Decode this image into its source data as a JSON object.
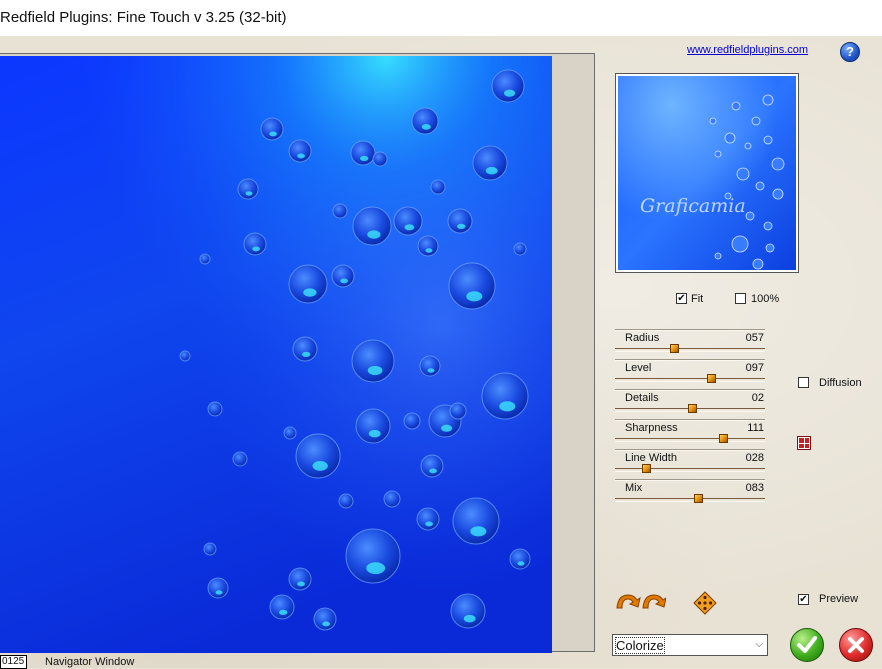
{
  "window": {
    "title": "Redfield Plugins: Fine Touch v 3.25 (32-bit)"
  },
  "header": {
    "link": "www.redfieldplugins.com",
    "help_icon": "?"
  },
  "thumbnail": {
    "watermark": "Graficamia"
  },
  "view_options": {
    "fit": {
      "label": "Fit",
      "checked": true
    },
    "full_size": {
      "label": "100%",
      "checked": false
    }
  },
  "sliders": [
    {
      "label": "Radius",
      "value": "057",
      "position": 0.39
    },
    {
      "label": "Level",
      "value": "097",
      "position": 0.65
    },
    {
      "label": "Details",
      "value": "02",
      "position": 0.52
    },
    {
      "label": "Sharpness",
      "value": "111",
      "position": 0.74
    },
    {
      "label": "Line Width",
      "value": "028",
      "position": 0.19
    },
    {
      "label": "Mix",
      "value": "083",
      "position": 0.56
    }
  ],
  "diffusion": {
    "label": "Diffusion",
    "checked": false
  },
  "preview": {
    "label": "Preview",
    "checked": true
  },
  "mode_select": {
    "value": "Colorize"
  },
  "navigator": {
    "zoom": "0125",
    "label": "Navigator Window"
  },
  "colors": {
    "water_deep": "#0a2fe6",
    "water_light": "#1d6cff",
    "accent_orange": "#e08a00"
  },
  "icons": {
    "help": "question-icon",
    "rotate": "rotate-arrows-icon",
    "random": "diamond-dots-icon",
    "pattern": "red-grid-icon",
    "ok": "checkmark-icon",
    "cancel": "x-icon"
  }
}
